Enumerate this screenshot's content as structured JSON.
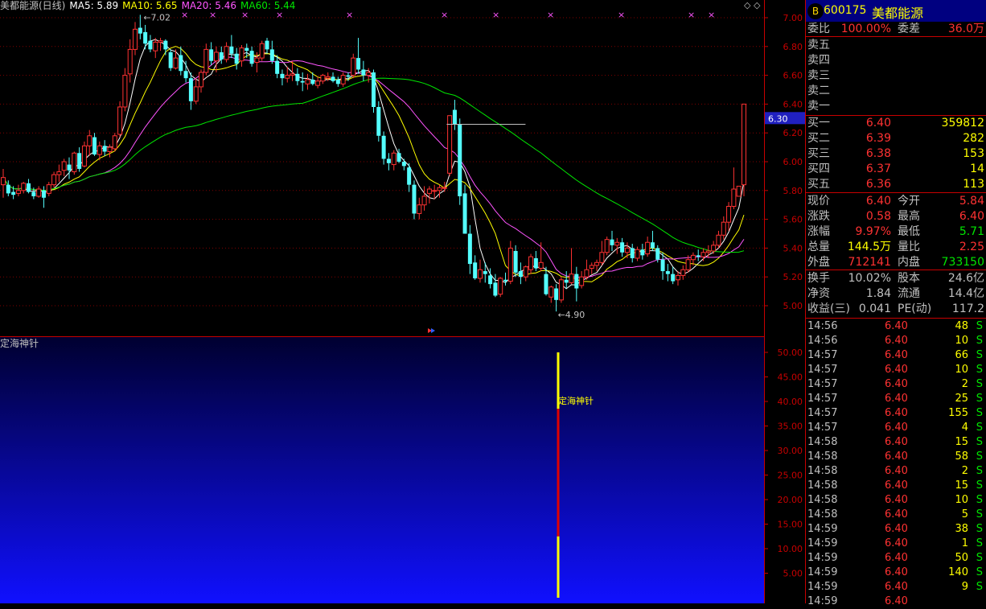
{
  "colors": {
    "up": "#ff3232",
    "down": "#54ffff",
    "ma5": "#ffffff",
    "ma10": "#ffff00",
    "ma20": "#ff55ff",
    "ma60": "#00e600",
    "grid": "#800000",
    "axis_text": "#c80000",
    "indicator_bg_top": "#000030",
    "indicator_bg_bottom": "#1010ff"
  },
  "legend": {
    "title": "美都能源(日线)",
    "ma5": "MA5: 5.89",
    "ma10": "MA10: 5.65",
    "ma20": "MA20: 5.46",
    "ma60": "MA60: 5.44"
  },
  "nav_icons": "◇ ◇",
  "price_axis": {
    "ticks": [
      "7.00",
      "6.80",
      "6.60",
      "6.40",
      "6.20",
      "6.00",
      "5.80",
      "5.60",
      "5.40",
      "5.20",
      "5.00"
    ],
    "current_label": "6.30",
    "high_label": "7.02",
    "low_label": "4.90"
  },
  "indicator": {
    "title": "定海神针",
    "signal_label": "定海神针",
    "ticks": [
      "50.00",
      "45.00",
      "40.00",
      "35.00",
      "30.00",
      "25.00",
      "20.00",
      "15.00",
      "10.00",
      "5.00"
    ],
    "bar_total": 50,
    "bar_red_from": 12.5,
    "bar_red_to": 38.5
  },
  "chart_data": {
    "type": "candlestick",
    "ylim": [
      4.9,
      7.07
    ],
    "candles": [
      [
        5.84,
        5.95,
        5.75,
        5.89
      ],
      [
        5.84,
        5.87,
        5.76,
        5.78
      ],
      [
        5.79,
        5.83,
        5.74,
        5.77
      ],
      [
        5.78,
        5.84,
        5.76,
        5.8
      ],
      [
        5.8,
        5.86,
        5.78,
        5.85
      ],
      [
        5.85,
        5.88,
        5.78,
        5.79
      ],
      [
        5.79,
        5.82,
        5.74,
        5.76
      ],
      [
        5.76,
        5.83,
        5.75,
        5.81
      ],
      [
        5.8,
        5.83,
        5.68,
        5.75
      ],
      [
        5.78,
        5.86,
        5.76,
        5.84
      ],
      [
        5.84,
        5.93,
        5.82,
        5.91
      ],
      [
        5.91,
        5.98,
        5.86,
        5.93
      ],
      [
        5.94,
        6.02,
        5.9,
        6.0
      ],
      [
        5.98,
        6.03,
        5.88,
        5.94
      ],
      [
        5.93,
        6.07,
        5.91,
        6.06
      ],
      [
        6.06,
        6.1,
        5.93,
        5.95
      ],
      [
        5.97,
        6.14,
        5.96,
        6.11
      ],
      [
        6.11,
        6.22,
        6.04,
        6.18
      ],
      [
        6.17,
        6.2,
        6.04,
        6.05
      ],
      [
        6.05,
        6.14,
        6.01,
        6.11
      ],
      [
        6.11,
        6.15,
        6.04,
        6.07
      ],
      [
        6.07,
        6.12,
        6.03,
        6.1
      ],
      [
        6.09,
        6.2,
        6.07,
        6.18
      ],
      [
        6.19,
        6.42,
        6.17,
        6.38
      ],
      [
        6.38,
        6.65,
        6.35,
        6.6
      ],
      [
        6.61,
        6.85,
        6.55,
        6.78
      ],
      [
        6.78,
        6.97,
        6.74,
        6.92
      ],
      [
        6.93,
        7.02,
        6.85,
        6.89
      ],
      [
        6.9,
        6.95,
        6.78,
        6.82
      ],
      [
        6.84,
        6.88,
        6.76,
        6.78
      ],
      [
        6.77,
        6.86,
        6.72,
        6.83
      ],
      [
        6.83,
        6.86,
        6.77,
        6.84
      ],
      [
        6.84,
        6.85,
        6.74,
        6.78
      ],
      [
        6.76,
        6.78,
        6.63,
        6.65
      ],
      [
        6.65,
        6.78,
        6.64,
        6.72
      ],
      [
        6.74,
        6.8,
        6.6,
        6.63
      ],
      [
        6.63,
        6.7,
        6.55,
        6.58
      ],
      [
        6.58,
        6.62,
        6.36,
        6.42
      ],
      [
        6.42,
        6.58,
        6.4,
        6.52
      ],
      [
        6.52,
        6.64,
        6.48,
        6.62
      ],
      [
        6.62,
        6.82,
        6.6,
        6.78
      ],
      [
        6.78,
        6.83,
        6.67,
        6.7
      ],
      [
        6.7,
        6.8,
        6.62,
        6.76
      ],
      [
        6.76,
        6.8,
        6.68,
        6.71
      ],
      [
        6.71,
        6.83,
        6.69,
        6.8
      ],
      [
        6.8,
        6.88,
        6.72,
        6.75
      ],
      [
        6.75,
        6.79,
        6.64,
        6.68
      ],
      [
        6.7,
        6.81,
        6.66,
        6.79
      ],
      [
        6.79,
        6.82,
        6.72,
        6.77
      ],
      [
        6.77,
        6.8,
        6.66,
        6.68
      ],
      [
        6.69,
        6.76,
        6.62,
        6.72
      ],
      [
        6.72,
        6.84,
        6.7,
        6.82
      ],
      [
        6.84,
        6.86,
        6.75,
        6.78
      ],
      [
        6.78,
        6.84,
        6.68,
        6.7
      ],
      [
        6.7,
        6.74,
        6.58,
        6.61
      ],
      [
        6.61,
        6.64,
        6.53,
        6.58
      ],
      [
        6.58,
        6.66,
        6.55,
        6.6
      ],
      [
        6.6,
        6.7,
        6.56,
        6.61
      ],
      [
        6.61,
        6.65,
        6.53,
        6.56
      ],
      [
        6.56,
        6.62,
        6.49,
        6.55
      ],
      [
        6.54,
        6.61,
        6.5,
        6.57
      ],
      [
        6.57,
        6.62,
        6.53,
        6.54
      ],
      [
        6.53,
        6.59,
        6.51,
        6.56
      ],
      [
        6.56,
        6.61,
        6.54,
        6.6
      ],
      [
        6.58,
        6.62,
        6.56,
        6.59
      ],
      [
        6.59,
        6.62,
        6.55,
        6.56
      ],
      [
        6.57,
        6.59,
        6.52,
        6.54
      ],
      [
        6.54,
        6.62,
        6.52,
        6.6
      ],
      [
        6.6,
        6.62,
        6.56,
        6.59
      ],
      [
        6.6,
        6.75,
        6.58,
        6.72
      ],
      [
        6.72,
        6.86,
        6.61,
        6.64
      ],
      [
        6.64,
        6.7,
        6.56,
        6.6
      ],
      [
        6.6,
        6.65,
        6.55,
        6.62
      ],
      [
        6.62,
        6.64,
        6.34,
        6.38
      ],
      [
        6.38,
        6.42,
        6.14,
        6.18
      ],
      [
        6.18,
        6.21,
        5.98,
        6.02
      ],
      [
        6.02,
        6.06,
        5.94,
        5.99
      ],
      [
        5.98,
        6.08,
        5.94,
        6.06
      ],
      [
        6.06,
        6.09,
        5.99,
        6.0
      ],
      [
        6.0,
        6.02,
        5.94,
        5.97
      ],
      [
        5.96,
        5.99,
        5.79,
        5.84
      ],
      [
        5.84,
        5.87,
        5.6,
        5.64
      ],
      [
        5.64,
        5.75,
        5.6,
        5.7
      ],
      [
        5.7,
        5.83,
        5.66,
        5.76
      ],
      [
        5.78,
        5.83,
        5.71,
        5.81
      ],
      [
        5.8,
        5.84,
        5.74,
        5.8
      ],
      [
        5.8,
        5.84,
        5.75,
        5.82
      ],
      [
        5.82,
        5.86,
        5.79,
        5.82
      ],
      [
        5.92,
        6.16,
        5.9,
        6.32
      ],
      [
        6.36,
        6.43,
        6.22,
        6.26
      ],
      [
        6.26,
        6.3,
        5.7,
        5.76
      ],
      [
        5.78,
        5.84,
        5.5,
        5.5
      ],
      [
        5.5,
        5.56,
        5.22,
        5.29
      ],
      [
        5.3,
        5.35,
        5.18,
        5.19
      ],
      [
        5.19,
        5.32,
        5.16,
        5.25
      ],
      [
        5.24,
        5.3,
        5.16,
        5.22
      ],
      [
        5.21,
        5.26,
        5.12,
        5.15
      ],
      [
        5.16,
        5.22,
        5.06,
        5.07
      ],
      [
        5.08,
        5.2,
        5.06,
        5.19
      ],
      [
        5.18,
        5.23,
        5.14,
        5.17
      ],
      [
        5.17,
        5.45,
        5.15,
        5.4
      ],
      [
        5.38,
        5.42,
        5.2,
        5.23
      ],
      [
        5.24,
        5.3,
        5.15,
        5.2
      ],
      [
        5.2,
        5.28,
        5.17,
        5.27
      ],
      [
        5.25,
        5.36,
        5.22,
        5.34
      ],
      [
        5.33,
        5.38,
        5.24,
        5.26
      ],
      [
        5.26,
        5.44,
        5.24,
        5.3
      ],
      [
        5.22,
        5.27,
        5.07,
        5.08
      ],
      [
        5.06,
        5.14,
        5.02,
        5.13
      ],
      [
        5.12,
        5.15,
        4.96,
        5.04
      ],
      [
        5.04,
        5.2,
        5.02,
        5.18
      ],
      [
        5.18,
        5.24,
        5.12,
        5.16
      ],
      [
        5.16,
        5.4,
        5.15,
        5.22
      ],
      [
        5.22,
        5.27,
        5.03,
        5.12
      ],
      [
        5.14,
        5.24,
        5.12,
        5.2
      ],
      [
        5.2,
        5.32,
        5.18,
        5.25
      ],
      [
        5.26,
        5.3,
        5.22,
        5.28
      ],
      [
        5.28,
        5.32,
        5.24,
        5.3
      ],
      [
        5.3,
        5.45,
        5.28,
        5.37
      ],
      [
        5.37,
        5.48,
        5.35,
        5.46
      ],
      [
        5.46,
        5.52,
        5.38,
        5.42
      ],
      [
        5.42,
        5.47,
        5.36,
        5.44
      ],
      [
        5.44,
        5.47,
        5.34,
        5.37
      ],
      [
        5.37,
        5.44,
        5.33,
        5.4
      ],
      [
        5.4,
        5.43,
        5.3,
        5.33
      ],
      [
        5.33,
        5.41,
        5.31,
        5.39
      ],
      [
        5.39,
        5.43,
        5.32,
        5.35
      ],
      [
        5.36,
        5.48,
        5.34,
        5.44
      ],
      [
        5.44,
        5.52,
        5.38,
        5.4
      ],
      [
        5.4,
        5.42,
        5.3,
        5.32
      ],
      [
        5.32,
        5.37,
        5.18,
        5.24
      ],
      [
        5.24,
        5.29,
        5.17,
        5.22
      ],
      [
        5.22,
        5.27,
        5.15,
        5.17
      ],
      [
        5.18,
        5.24,
        5.14,
        5.21
      ],
      [
        5.21,
        5.28,
        5.18,
        5.25
      ],
      [
        5.25,
        5.35,
        5.23,
        5.32
      ],
      [
        5.32,
        5.37,
        5.28,
        5.35
      ],
      [
        5.35,
        5.39,
        5.31,
        5.34
      ],
      [
        5.34,
        5.4,
        5.31,
        5.37
      ],
      [
        5.37,
        5.42,
        5.33,
        5.38
      ],
      [
        5.38,
        5.45,
        5.36,
        5.42
      ],
      [
        5.42,
        5.52,
        5.4,
        5.49
      ],
      [
        5.49,
        5.62,
        5.46,
        5.58
      ],
      [
        5.58,
        5.72,
        5.52,
        5.69
      ],
      [
        5.69,
        5.96,
        5.67,
        5.81
      ],
      [
        5.76,
        5.83,
        5.76,
        5.83
      ],
      [
        5.84,
        6.4,
        5.76,
        6.4
      ]
    ]
  },
  "quote": {
    "logo": "B",
    "code": "600175",
    "name": "美都能源",
    "weibi_label": "委比",
    "weibi": "100.00%",
    "weicha_label": "委差",
    "weicha": "36.0万",
    "asks": [
      {
        "label": "卖五",
        "price": "",
        "vol": ""
      },
      {
        "label": "卖四",
        "price": "",
        "vol": ""
      },
      {
        "label": "卖三",
        "price": "",
        "vol": ""
      },
      {
        "label": "卖二",
        "price": "",
        "vol": ""
      },
      {
        "label": "卖一",
        "price": "",
        "vol": ""
      }
    ],
    "bids": [
      {
        "label": "买一",
        "price": "6.40",
        "vol": "359812"
      },
      {
        "label": "买二",
        "price": "6.39",
        "vol": "282"
      },
      {
        "label": "买三",
        "price": "6.38",
        "vol": "153"
      },
      {
        "label": "买四",
        "price": "6.37",
        "vol": "14"
      },
      {
        "label": "买五",
        "price": "6.36",
        "vol": "113"
      }
    ],
    "stats": [
      {
        "l1": "现价",
        "v1": "6.40",
        "c1": "red",
        "l2": "今开",
        "v2": "5.84",
        "c2": "red"
      },
      {
        "l1": "涨跌",
        "v1": "0.58",
        "c1": "red",
        "l2": "最高",
        "v2": "6.40",
        "c2": "red"
      },
      {
        "l1": "涨幅",
        "v1": "9.97%",
        "c1": "red",
        "l2": "最低",
        "v2": "5.71",
        "c2": "grn"
      },
      {
        "l1": "总量",
        "v1": "144.5万",
        "c1": "yel",
        "l2": "量比",
        "v2": "2.25",
        "c2": "red"
      },
      {
        "l1": "外盘",
        "v1": "712141",
        "c1": "red",
        "l2": "内盘",
        "v2": "733150",
        "c2": "grn"
      }
    ],
    "fund": [
      {
        "l1": "换手",
        "v1": "10.02%",
        "l2": "股本",
        "v2": "24.6亿"
      },
      {
        "l1": "净资",
        "v1": "1.84",
        "l2": "流通",
        "v2": "14.4亿"
      },
      {
        "l1": "收益(三)",
        "v1": "0.041",
        "l2": "PE(动)",
        "v2": "117.2"
      }
    ]
  },
  "ticks": [
    {
      "time": "14:56",
      "price": "6.40",
      "vol": "48",
      "side": "S"
    },
    {
      "time": "14:56",
      "price": "6.40",
      "vol": "10",
      "side": "S"
    },
    {
      "time": "14:57",
      "price": "6.40",
      "vol": "66",
      "side": "S"
    },
    {
      "time": "14:57",
      "price": "6.40",
      "vol": "10",
      "side": "S"
    },
    {
      "time": "14:57",
      "price": "6.40",
      "vol": "2",
      "side": "S"
    },
    {
      "time": "14:57",
      "price": "6.40",
      "vol": "25",
      "side": "S"
    },
    {
      "time": "14:57",
      "price": "6.40",
      "vol": "155",
      "side": "S"
    },
    {
      "time": "14:57",
      "price": "6.40",
      "vol": "4",
      "side": "S"
    },
    {
      "time": "14:58",
      "price": "6.40",
      "vol": "15",
      "side": "S"
    },
    {
      "time": "14:58",
      "price": "6.40",
      "vol": "58",
      "side": "S"
    },
    {
      "time": "14:58",
      "price": "6.40",
      "vol": "2",
      "side": "S"
    },
    {
      "time": "14:58",
      "price": "6.40",
      "vol": "15",
      "side": "S"
    },
    {
      "time": "14:58",
      "price": "6.40",
      "vol": "10",
      "side": "S"
    },
    {
      "time": "14:58",
      "price": "6.40",
      "vol": "5",
      "side": "S"
    },
    {
      "time": "14:59",
      "price": "6.40",
      "vol": "38",
      "side": "S"
    },
    {
      "time": "14:59",
      "price": "6.40",
      "vol": "1",
      "side": "S"
    },
    {
      "time": "14:59",
      "price": "6.40",
      "vol": "50",
      "side": "S"
    },
    {
      "time": "14:59",
      "price": "6.40",
      "vol": "140",
      "side": "S"
    },
    {
      "time": "14:59",
      "price": "6.40",
      "vol": "9",
      "side": "S"
    },
    {
      "time": "14:59",
      "price": "6.40",
      "vol": "",
      "side": ""
    }
  ]
}
